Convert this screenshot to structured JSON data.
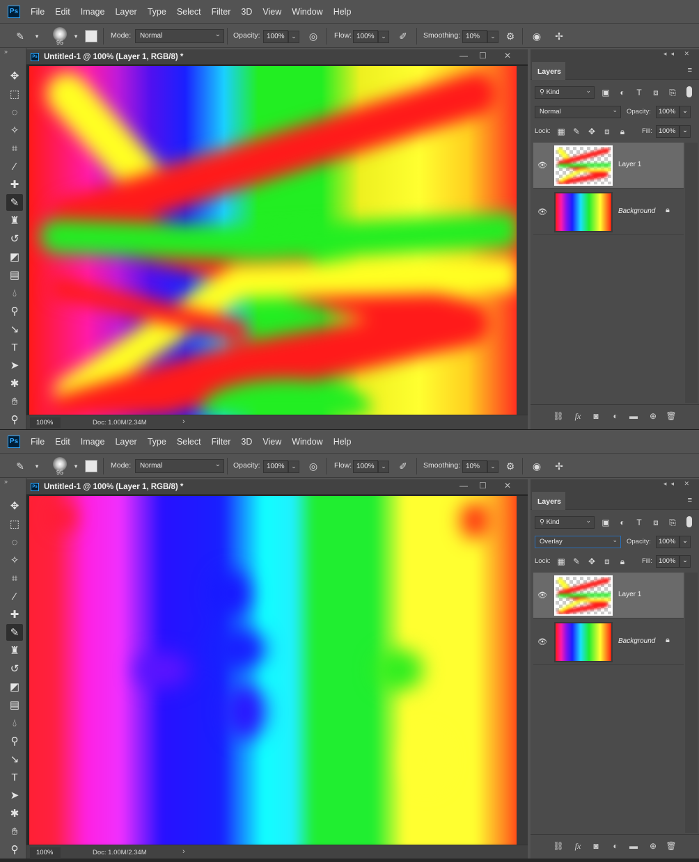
{
  "menu": [
    "File",
    "Edit",
    "Image",
    "Layer",
    "Type",
    "Select",
    "Filter",
    "3D",
    "View",
    "Window",
    "Help"
  ],
  "app_logo": "Ps",
  "options": {
    "brush_size": "95",
    "mode_label": "Mode:",
    "mode_value": "Normal",
    "opacity_label": "Opacity:",
    "opacity_value": "100%",
    "flow_label": "Flow:",
    "flow_value": "100%",
    "smoothing_label": "Smoothing:",
    "smoothing_value": "10%"
  },
  "document": {
    "title": "Untitled-1 @ 100% (Layer 1, RGB/8) *",
    "zoom": "100%",
    "doc_info": "Doc: 1.00M/2.34M"
  },
  "layers_panel": {
    "tab_label": "Layers",
    "filter_kind": "Kind",
    "opacity_label": "Opacity:",
    "opacity_value": "100%",
    "lock_label": "Lock:",
    "fill_label": "Fill:",
    "fill_value": "100%",
    "layers": [
      {
        "name": "Layer 1"
      },
      {
        "name": "Background"
      }
    ]
  },
  "screens": [
    {
      "blend_mode": "Normal"
    },
    {
      "blend_mode": "Overlay"
    }
  ],
  "icons": {
    "tools": [
      "move-icon",
      "marquee-icon",
      "lasso-icon",
      "magic-wand-icon",
      "crop-icon",
      "eyedropper-icon",
      "healing-brush-icon",
      "brush-icon",
      "clone-stamp-icon",
      "history-brush-icon",
      "eraser-icon",
      "gradient-icon",
      "blur-icon",
      "dodge-icon",
      "pen-icon",
      "type-icon",
      "path-select-icon",
      "shape-icon",
      "hand-icon",
      "zoom-icon"
    ]
  }
}
